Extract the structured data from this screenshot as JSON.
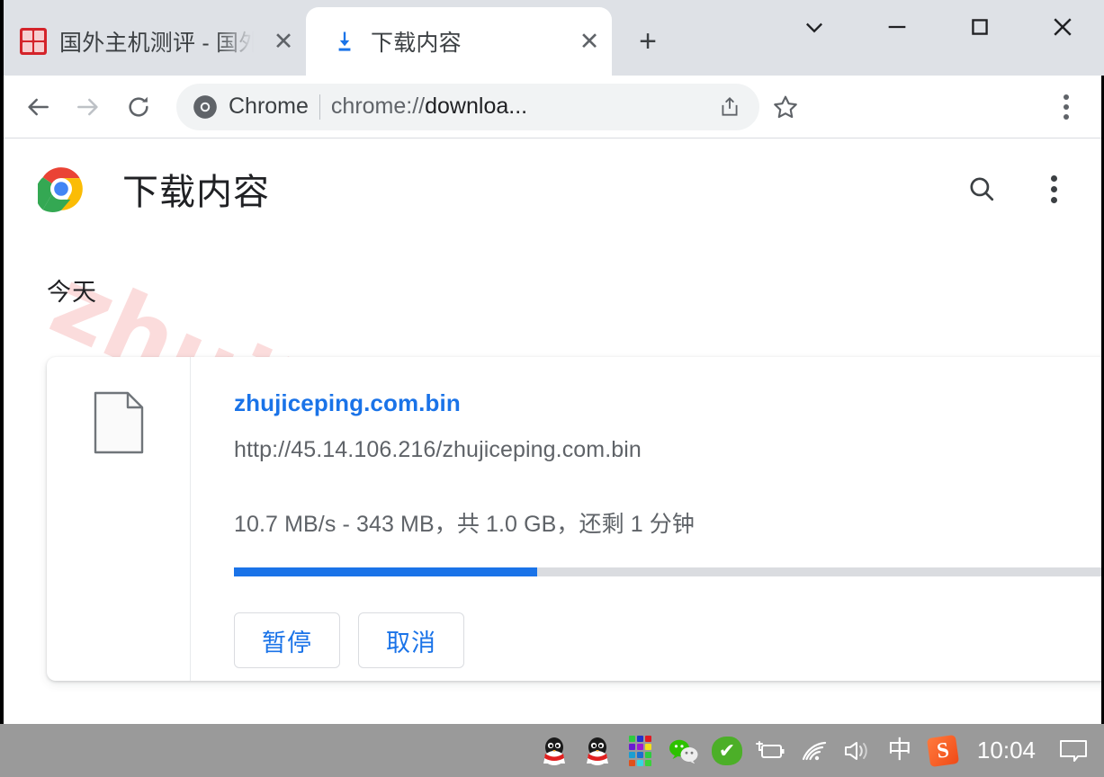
{
  "browser": {
    "tabs": [
      {
        "title": "国外主机测评 - 国外",
        "favicon": "red-square-favicon",
        "active": false,
        "close_label": "✕"
      },
      {
        "title": "下载内容",
        "favicon": "download-arrow-icon",
        "active": true,
        "close_label": "✕"
      }
    ],
    "new_tab_label": "+",
    "window_controls": [
      {
        "name": "tab-search",
        "glyph": "⌄"
      },
      {
        "name": "minimize",
        "glyph": "—"
      },
      {
        "name": "maximize",
        "glyph": "▭"
      },
      {
        "name": "close",
        "glyph": "✕"
      }
    ],
    "toolbar": {
      "back": "←",
      "forward": "→",
      "reload": "⟳",
      "omnibox": {
        "scheme_label": "Chrome",
        "url_prefix": "chrome://",
        "url_body": "downloa...",
        "share_icon": "share-icon",
        "bookmark_icon": "star-icon"
      },
      "menu_icon": "three-dot-menu-icon"
    }
  },
  "page": {
    "title": "下载内容",
    "logo": "chrome-logo",
    "search_icon": "search-icon",
    "more_icon": "three-dot-menu-icon",
    "section_label": "今天",
    "watermark": "zhujiceping.com",
    "download": {
      "file_icon": "generic-file-icon",
      "file_name": "zhujiceping.com.bin",
      "source_url": "http://45.14.106.216/zhujiceping.com.bin",
      "status": "10.7 MB/s - 343 MB，共 1.0 GB，还剩 1 分钟",
      "progress_percent": 33,
      "progress_color": "#1a73e8",
      "pause_label": "暂停",
      "cancel_label": "取消"
    }
  },
  "taskbar": {
    "items": [
      {
        "name": "qq-icon-1",
        "label": ""
      },
      {
        "name": "qq-icon-2",
        "label": ""
      },
      {
        "name": "color-grid-icon",
        "label": ""
      },
      {
        "name": "wechat-icon",
        "label": ""
      },
      {
        "name": "green-check-icon",
        "label": "✔"
      },
      {
        "name": "battery-charging-icon",
        "label": ""
      },
      {
        "name": "wifi-icon",
        "label": ""
      },
      {
        "name": "volume-icon",
        "label": ""
      },
      {
        "name": "ime-chinese-icon",
        "label": "中"
      },
      {
        "name": "sogou-icon",
        "label": "S"
      }
    ],
    "clock": "10:04",
    "notification_icon": "notification-icon"
  },
  "colors": {
    "accent": "#1a73e8",
    "tabstrip": "#dee1e6",
    "taskbar": "#9a9a9a",
    "watermark": "#fbdcdc"
  }
}
